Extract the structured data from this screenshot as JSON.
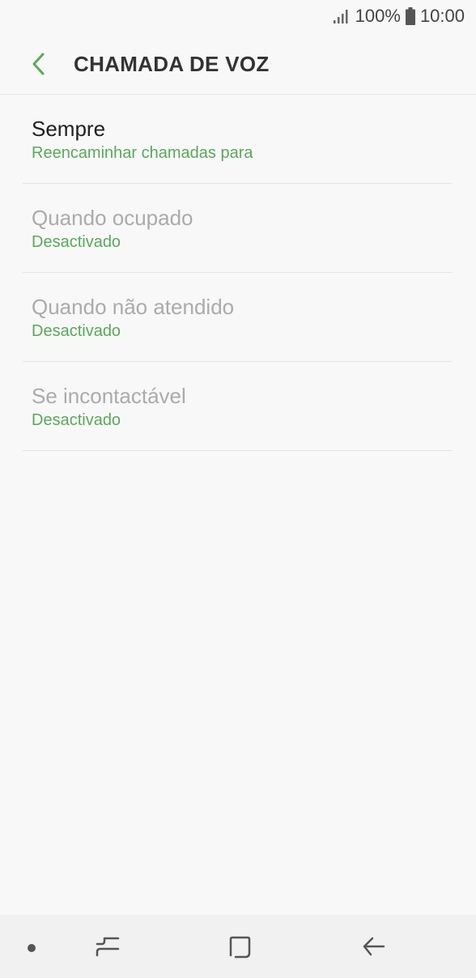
{
  "status_bar": {
    "battery_percent": "100%",
    "time": "10:00",
    "icons": [
      "signal-icon",
      "battery-icon"
    ]
  },
  "app_bar": {
    "title": "CHAMADA DE VOZ",
    "back_icon": "chevron-left-icon"
  },
  "items": [
    {
      "title": "Sempre",
      "subtitle": "Reencaminhar chamadas para",
      "enabled": true
    },
    {
      "title": "Quando ocupado",
      "subtitle": "Desactivado",
      "enabled": false
    },
    {
      "title": "Quando não atendido",
      "subtitle": "Desactivado",
      "enabled": false
    },
    {
      "title": "Se incontactável",
      "subtitle": "Desactivado",
      "enabled": false
    }
  ],
  "nav_bar": {
    "icons": [
      "dot-icon",
      "recent-apps-icon",
      "home-icon",
      "back-arrow-icon"
    ]
  },
  "colors": {
    "accent": "#5ba85a",
    "background": "#f8f8f8",
    "title_text": "#333333",
    "disabled_text": "#ababab"
  }
}
